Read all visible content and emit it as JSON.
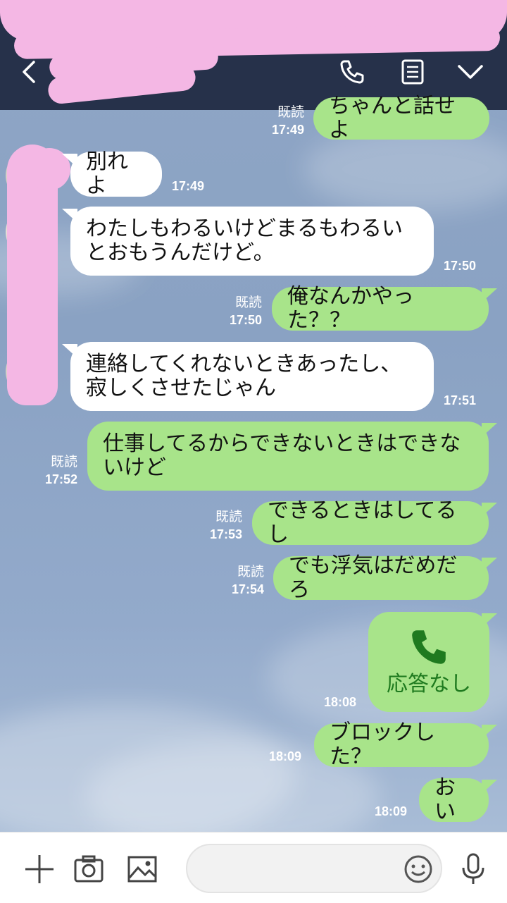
{
  "header": {
    "back_icon": "chevron-left-icon",
    "call_icon": "phone-icon",
    "notes_icon": "notes-icon",
    "menu_icon": "chevron-down-icon"
  },
  "messages": [
    {
      "id": "m1",
      "side": "out",
      "text": "ちゃんと話せよ",
      "read": "既読",
      "time": "17:49"
    },
    {
      "id": "m2",
      "side": "in",
      "text": "別れよ",
      "time": "17:49"
    },
    {
      "id": "m3",
      "side": "in",
      "text": "わたしもわるいけどまるもわるい\nとおもうんだけど。",
      "time": "17:50"
    },
    {
      "id": "m4",
      "side": "out",
      "text": "俺なんかやった？？",
      "read": "既読",
      "time": "17:50"
    },
    {
      "id": "m5",
      "side": "in",
      "text": "連絡してくれないときあったし、\n寂しくさせたじゃん",
      "time": "17:51"
    },
    {
      "id": "m6",
      "side": "out",
      "text": "仕事してるからできないときはできな\nいけど",
      "read": "既読",
      "time": "17:52"
    },
    {
      "id": "m7",
      "side": "out",
      "text": "できるときはしてるし",
      "read": "既読",
      "time": "17:53"
    },
    {
      "id": "m8",
      "side": "out",
      "text": "でも浮気はだめだろ",
      "read": "既読",
      "time": "17:54"
    },
    {
      "id": "m9",
      "side": "out",
      "type": "call",
      "text": "応答なし",
      "time": "18:08"
    },
    {
      "id": "m10",
      "side": "out",
      "text": "ブロックした？",
      "time": "18:09"
    },
    {
      "id": "m11",
      "side": "out",
      "text": "おい",
      "time": "18:09"
    }
  ],
  "input_bar": {
    "plus_icon": "plus-icon",
    "camera_icon": "camera-icon",
    "image_icon": "image-icon",
    "emoji_icon": "emoji-icon",
    "mic_icon": "microphone-icon",
    "placeholder": ""
  },
  "colors": {
    "header_bg": "#26314a",
    "bubble_out": "#a8e48a",
    "bubble_in": "#ffffff",
    "call_green": "#1f7a1f",
    "redaction_pink": "#f4b7e4"
  }
}
